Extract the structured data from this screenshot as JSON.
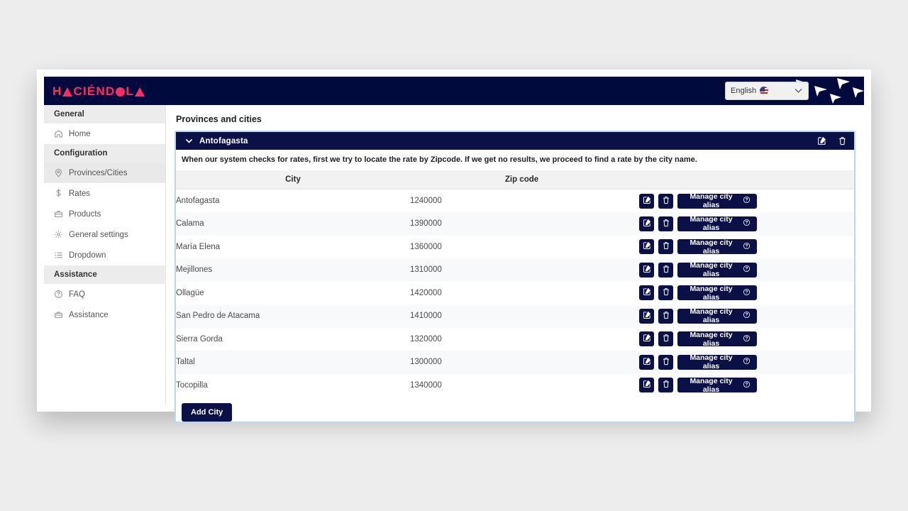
{
  "brand": {
    "logo_text": "HACIÉNDOLA",
    "logo_color": "#ff2d62",
    "navy": "#000a3c",
    "button_navy": "#0b1147"
  },
  "header": {
    "language_label": "English",
    "language_flag": "us-flag-icon",
    "chevron": "chevron-down-icon",
    "decoration": "paper-planes"
  },
  "sidebar": {
    "groups": [
      {
        "label": "General",
        "items": [
          {
            "label": "Home",
            "icon": "home-icon",
            "active": false
          }
        ]
      },
      {
        "label": "Configuration",
        "items": [
          {
            "label": "Provinces/Cities",
            "icon": "map-pin-icon",
            "active": true
          },
          {
            "label": "Rates",
            "icon": "dollar-icon",
            "active": false
          },
          {
            "label": "Products",
            "icon": "briefcase-icon",
            "active": false
          },
          {
            "label": "General settings",
            "icon": "gear-icon",
            "active": false
          },
          {
            "label": "Dropdown",
            "icon": "list-icon",
            "active": false
          }
        ]
      },
      {
        "label": "Assistance",
        "items": [
          {
            "label": "FAQ",
            "icon": "question-circle-icon",
            "active": false
          },
          {
            "label": "Assistance",
            "icon": "toolbox-icon",
            "active": false
          }
        ]
      }
    ]
  },
  "main": {
    "page_title": "Provinces and cities",
    "accordion": {
      "title": "Antofagasta",
      "expanded": true,
      "chevron_icon": "chevron-down-icon",
      "edit_icon": "edit-square-icon",
      "delete_icon": "trash-icon"
    },
    "note": "When our system checks for rates, first we try to locate the rate by Zipcode. If we get no results, we proceed to find a rate by the city name.",
    "table": {
      "columns": [
        "City",
        "Zip code",
        ""
      ],
      "row_buttons": {
        "edit_icon": "edit-square-icon",
        "delete_icon": "trash-icon",
        "alias_label": "Manage city alias",
        "alias_help_icon": "question-circle-icon"
      },
      "rows": [
        {
          "city": "Antofagasta",
          "zip": "1240000"
        },
        {
          "city": "Calama",
          "zip": "1390000"
        },
        {
          "city": "María Elena",
          "zip": "1360000"
        },
        {
          "city": "Mejillones",
          "zip": "1310000"
        },
        {
          "city": "Ollagüe",
          "zip": "1420000"
        },
        {
          "city": "San Pedro de Atacama",
          "zip": "1410000"
        },
        {
          "city": "Sierra Gorda",
          "zip": "1320000"
        },
        {
          "city": "Taltal",
          "zip": "1300000"
        },
        {
          "city": "Tocopilla",
          "zip": "1340000"
        }
      ]
    },
    "add_city_label": "Add City"
  }
}
